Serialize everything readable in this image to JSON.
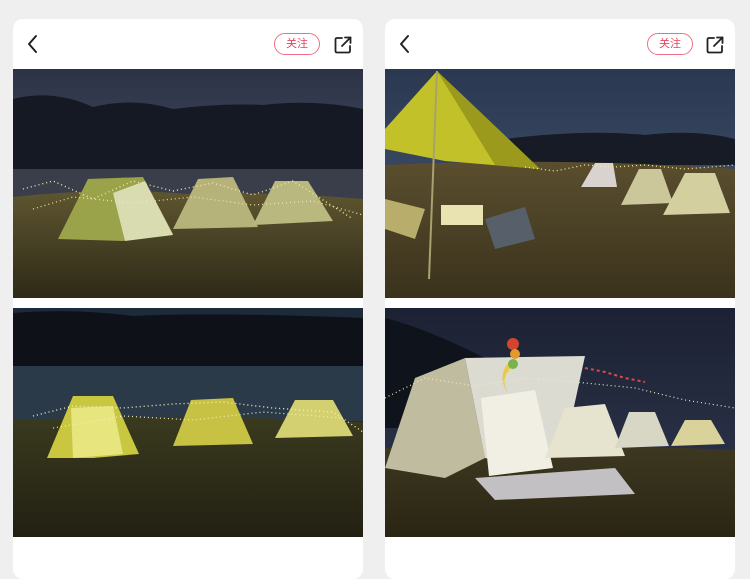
{
  "cards": [
    {
      "follow_label": "关注",
      "icons": {
        "back": "chevron-left-icon",
        "share": "share-out-icon"
      },
      "photos": [
        "camping-tents-night-lakeside",
        "camping-tents-night-lights"
      ]
    },
    {
      "follow_label": "关注",
      "icons": {
        "back": "chevron-left-icon",
        "share": "share-out-icon"
      },
      "photos": [
        "tarp-camp-chairs-night",
        "tents-with-moon-star-lights"
      ]
    }
  ],
  "colors": {
    "accent": "#ee3f5d",
    "accent_border": "#f06e85",
    "background": "#efefef",
    "card": "#ffffff"
  }
}
